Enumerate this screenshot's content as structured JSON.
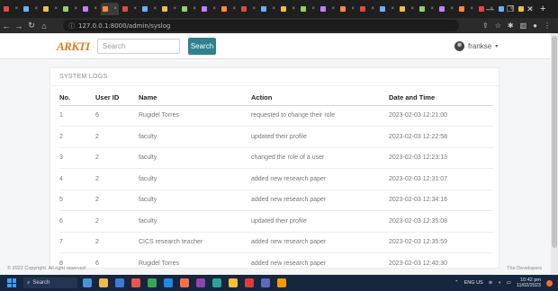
{
  "browser": {
    "tab_count": 27,
    "tab_favicon_colors": [
      "#e84545",
      "#6ab0ff",
      "#f0c040",
      "#8fd36a",
      "#c77dff",
      "#ff8a3d"
    ],
    "url": "127.0.0.1:8000/admin/syslog",
    "new_tab_label": "+"
  },
  "navbar": {
    "logo_text": "ARKTI",
    "search_placeholder": "Search",
    "search_button": "Search",
    "user_name": "frankse",
    "user_caret": "▾"
  },
  "logs": {
    "title": "SYSTEM LOGS",
    "columns": [
      "No.",
      "User ID",
      "Name",
      "Action",
      "Date and Time"
    ],
    "rows": [
      {
        "no": "1",
        "user_id": "6",
        "name": "Rugidel Torres",
        "action": "requested to change their role",
        "datetime": "2023-02-03 12:21:00"
      },
      {
        "no": "2",
        "user_id": "2",
        "name": "faculty",
        "action": "updated their profile",
        "datetime": "2023-02-03 12:22:58"
      },
      {
        "no": "3",
        "user_id": "2",
        "name": "faculty",
        "action": "changed the role of a user",
        "datetime": "2023-02-03 12:23:13"
      },
      {
        "no": "4",
        "user_id": "2",
        "name": "faculty",
        "action": "added new research paper",
        "datetime": "2023-02-03 12:31:07"
      },
      {
        "no": "5",
        "user_id": "2",
        "name": "faculty",
        "action": "added new research paper",
        "datetime": "2023-02-03 12:34:16"
      },
      {
        "no": "6",
        "user_id": "2",
        "name": "faculty",
        "action": "updated their profile",
        "datetime": "2023-02-03 12:35:08"
      },
      {
        "no": "7",
        "user_id": "2",
        "name": "CICS research teacher",
        "action": "added new research paper",
        "datetime": "2023-02-03 12:35:59"
      },
      {
        "no": "8",
        "user_id": "6",
        "name": "Rugidel Torres",
        "action": "added new research paper",
        "datetime": "2023-02-03 12:40:30"
      }
    ]
  },
  "footer": {
    "copyright": "© 2022 Copyright. All right reserved",
    "developers": "The Developers"
  },
  "taskbar": {
    "search_label": "Search",
    "app_icon_colors": [
      "#4a90d9",
      "#f2b84b",
      "#3a7bd5",
      "#e8574a",
      "#34a853",
      "#1e88e5",
      "#ff7043",
      "#8e44ad",
      "#26a69a",
      "#fbc02d",
      "#e53935",
      "#5c6bc0",
      "#ff9800"
    ],
    "tray_lang": "ENG US",
    "time": "10:42 pm",
    "date": "11/02/2023"
  }
}
